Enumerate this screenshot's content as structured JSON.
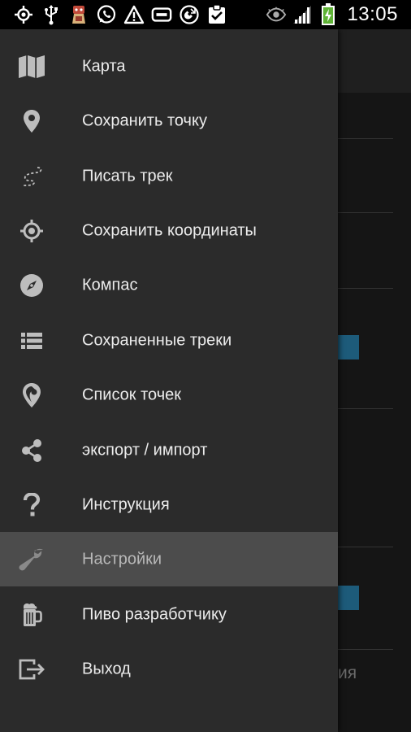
{
  "status_bar": {
    "time": "13:05",
    "icons": [
      "gps-icon",
      "usb-icon",
      "app-notification-icon",
      "whatsapp-icon",
      "warning-icon",
      "sd-card-icon",
      "call-icon",
      "clipboard-check-icon",
      "eye-icon",
      "signal-icon",
      "battery-charging-icon"
    ]
  },
  "background": {
    "partial_text": "ия"
  },
  "drawer": {
    "items": [
      {
        "label": "Карта",
        "icon": "map-icon"
      },
      {
        "label": "Сохранить точку",
        "icon": "map-pin-icon"
      },
      {
        "label": "Писать трек",
        "icon": "track-path-icon"
      },
      {
        "label": "Сохранить координаты",
        "icon": "crosshair-icon"
      },
      {
        "label": "Компас",
        "icon": "compass-icon"
      },
      {
        "label": "Сохраненные треки",
        "icon": "list-icon"
      },
      {
        "label": "Список точек",
        "icon": "pin-list-icon"
      },
      {
        "label": "экспорт / импорт",
        "icon": "share-icon"
      },
      {
        "label": "Инструкция",
        "icon": "help-icon"
      },
      {
        "label": "Настройки",
        "icon": "wrench-icon",
        "active": true
      },
      {
        "label": "Пиво разработчику",
        "icon": "beer-icon"
      },
      {
        "label": "Выход",
        "icon": "exit-icon"
      }
    ]
  },
  "colors": {
    "drawer_bg": "#2b2b2b",
    "active_item_bg": "#4c4c4c",
    "icon": "#bdbdbd",
    "text": "#ececec",
    "accent_blue": "#1d5b7a"
  }
}
